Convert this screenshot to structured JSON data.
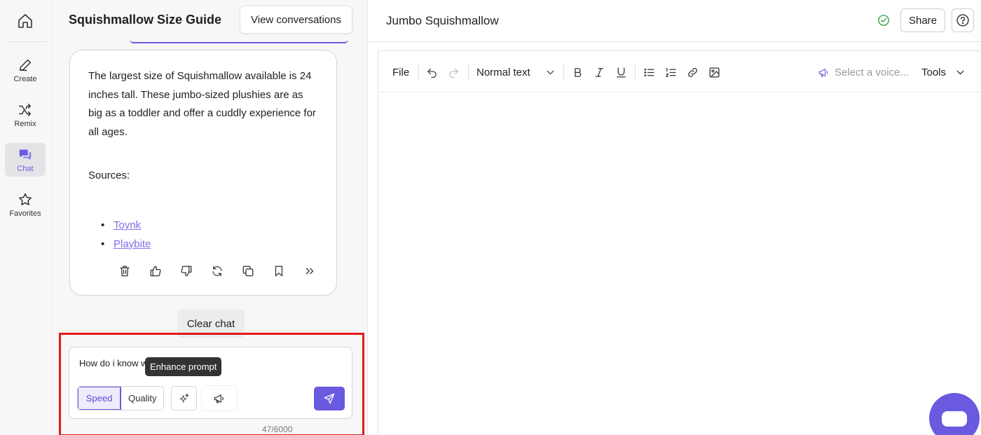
{
  "rail": {
    "items": [
      {
        "label": "Create",
        "icon": "pen-icon"
      },
      {
        "label": "Remix",
        "icon": "shuffle-icon"
      },
      {
        "label": "Chat",
        "icon": "chat-icon"
      },
      {
        "label": "Favorites",
        "icon": "star-icon"
      }
    ]
  },
  "chat": {
    "title": "Squishmallow Size Guide",
    "view_conversations": "View conversations",
    "message": {
      "text": "The largest size of Squishmallow available is 24 inches tall. These jumbo-sized plushies are as big as a toddler and offer a cuddly experience for all ages.",
      "sources_label": "Sources:",
      "links": [
        "Toynk",
        "Playbite"
      ]
    },
    "clear_chat": "Clear chat",
    "input": {
      "value": "How do i know wh… good enough",
      "tooltip": "Enhance prompt",
      "mode_speed": "Speed",
      "mode_quality": "Quality",
      "char_count": "47/6000"
    }
  },
  "document": {
    "title": "Jumbo Squishmallow",
    "share": "Share",
    "toolbar": {
      "file": "File",
      "text_style": "Normal text",
      "voice_placeholder": "Select a voice...",
      "tools": "Tools"
    }
  },
  "colors": {
    "accent": "#6a5ae0",
    "highlight": "#e11b1b",
    "saved": "#2e9d47"
  }
}
